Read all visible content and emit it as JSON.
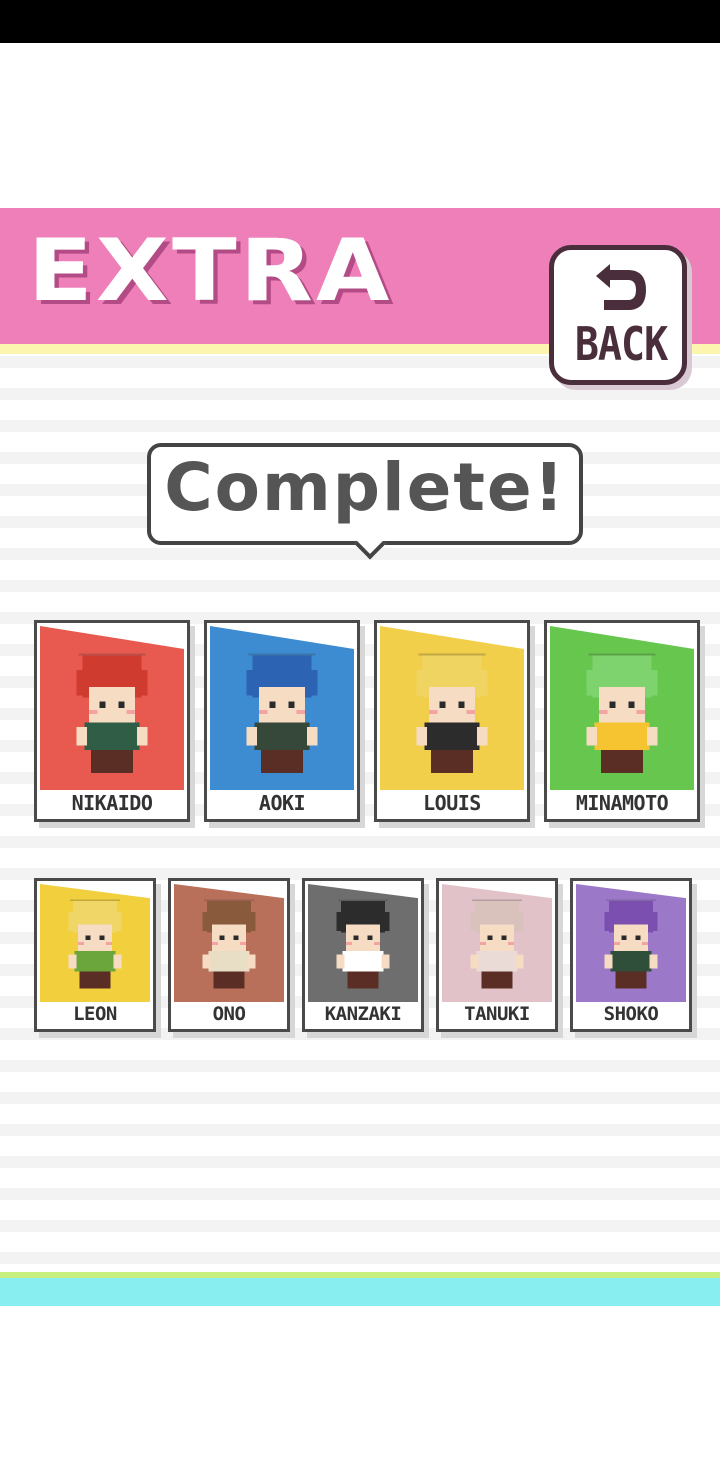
{
  "screen": {
    "title": "EXTRA",
    "back_label": "BACK",
    "complete_label": "Complete!"
  },
  "colors": {
    "header": "#ef7fb8",
    "header_stripe": "#fbf5b0",
    "footer_stripe": "#c7f07e",
    "footer": "#88eef0"
  },
  "characters_row1": [
    {
      "name": "NIKAIDO",
      "color": "#e85a4f",
      "hair": "#cf3b2f",
      "shirt": "#2f5d45"
    },
    {
      "name": "AOKI",
      "color": "#3d8bd0",
      "hair": "#2d63b3",
      "shirt": "#35483a"
    },
    {
      "name": "LOUIS",
      "color": "#f2cf4a",
      "hair": "#f0d462",
      "shirt": "#2c2c2c"
    },
    {
      "name": "MINAMOTO",
      "color": "#66c64e",
      "hair": "#7ed36e",
      "shirt": "#f5c430"
    }
  ],
  "characters_row2": [
    {
      "name": "LEON",
      "color": "#f2cf3c",
      "hair": "#f0d667",
      "shirt": "#6aa63c"
    },
    {
      "name": "ONO",
      "color": "#b8705a",
      "hair": "#8a5a3c",
      "shirt": "#e8ddc5"
    },
    {
      "name": "KANZAKI",
      "color": "#6e6e6e",
      "hair": "#2c2c2c",
      "shirt": "#ffffff"
    },
    {
      "name": "TANUKI",
      "color": "#e1c2c8",
      "hair": "#d9c2bc",
      "shirt": "#eadbd6"
    },
    {
      "name": "SHOKO",
      "color": "#9c79c8",
      "hair": "#7b4fb0",
      "shirt": "#2f4f3a"
    }
  ]
}
